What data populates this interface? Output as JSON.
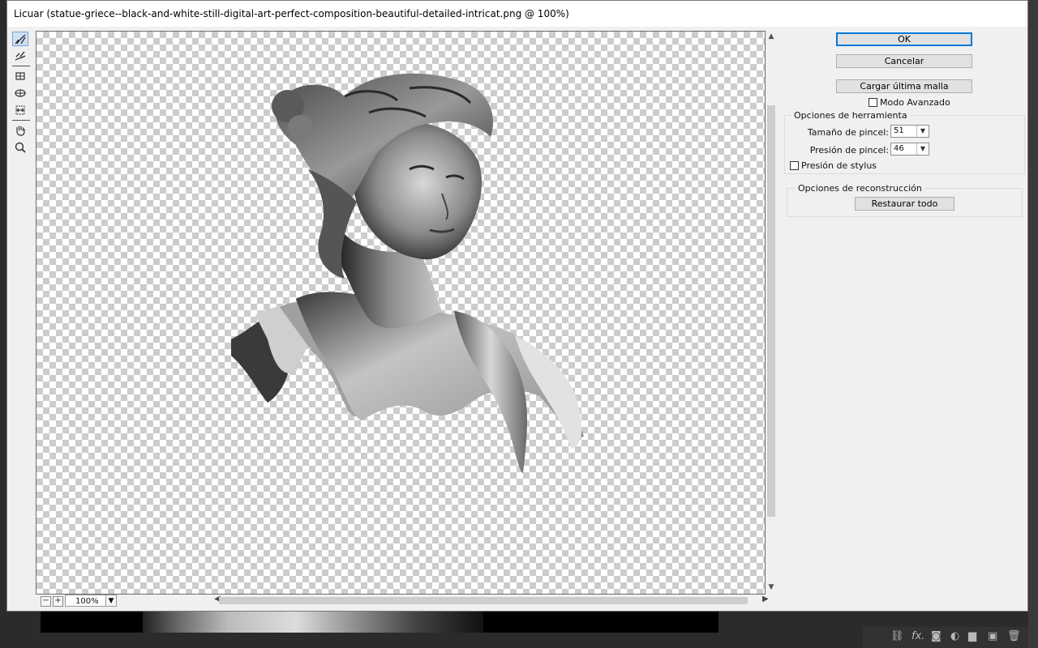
{
  "dialog": {
    "title": "Licuar (statue-griece--black-and-white-still-digital-art-perfect-composition-beautiful-detailed-intricat.png @ 100%)"
  },
  "tools": [
    {
      "icon": "forward-warp-icon",
      "active": true
    },
    {
      "icon": "reconstruct-icon",
      "active": false
    },
    {
      "icon": "pucker-icon",
      "active": false
    },
    {
      "icon": "bloat-icon",
      "active": false
    },
    {
      "icon": "push-left-icon",
      "active": false
    },
    {
      "icon": "hand-icon",
      "active": false
    },
    {
      "icon": "zoom-icon",
      "active": false
    }
  ],
  "preview": {
    "zoom_value": "100%",
    "zoom_out_glyph": "−",
    "zoom_in_glyph": "+"
  },
  "actions": {
    "ok": "OK",
    "cancel": "Cancelar",
    "load_mesh": "Cargar última malla",
    "advanced_mode": "Modo Avanzado"
  },
  "tool_options": {
    "title": "Opciones de herramienta",
    "brush_size_label": "Tamaño de pincel:",
    "brush_size_value": "51",
    "brush_pressure_label": "Presión de pincel:",
    "brush_pressure_value": "46",
    "stylus_pressure_label": "Presión de stylus"
  },
  "reconstruct_options": {
    "title": "Opciones de reconstrucción",
    "restore_all": "Restaurar todo"
  },
  "background": {
    "layers_icons": [
      "link-icon",
      "fx-icon",
      "mask-icon",
      "adjustment-icon",
      "folder-icon",
      "new-layer-icon",
      "trash-icon"
    ],
    "fx_label": "fx."
  },
  "colors": {
    "accent": "#0078d7",
    "dialog_bg": "#f0f0f0",
    "checker": "#cccccc"
  }
}
